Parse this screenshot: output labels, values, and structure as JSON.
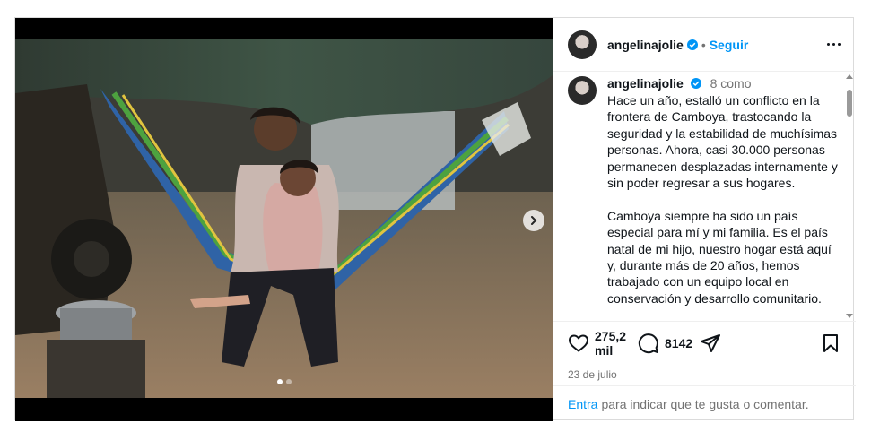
{
  "post": {
    "username": "angelinajolie",
    "follow_label": "Seguir",
    "separator": "•",
    "caption_time": "8 como",
    "caption_text": "Hace un año, estalló un conflicto en la frontera de Camboya, trastocando la seguridad y la estabilidad de muchísimas personas. Ahora, casi 30.000 personas permanecen desplazadas internamente y sin poder regresar a sus hogares.\n\nCamboya siempre ha sido un país especial para mí y mi familia. Es el país natal de mi hijo, nuestro hogar está aquí y, durante más de 20 años, hemos trabajado con un equipo local en conservación y desarrollo comunitario.",
    "likes": "275,2 mil",
    "comments": "8142",
    "date": "23 de julio",
    "carousel": {
      "total": 2,
      "active": 1
    }
  },
  "comment_bar": {
    "link": "Entra",
    "text": "para indicar que te gusta o comentar."
  },
  "icons": {
    "verified": "verified-badge-icon",
    "more": "more-options-icon",
    "like": "heart-icon",
    "comment": "comment-bubble-icon",
    "share": "paper-plane-icon",
    "save": "bookmark-icon",
    "next": "chevron-right-icon"
  },
  "colors": {
    "accent": "#0095f6",
    "muted": "#737373",
    "verified": "#0095f6"
  }
}
